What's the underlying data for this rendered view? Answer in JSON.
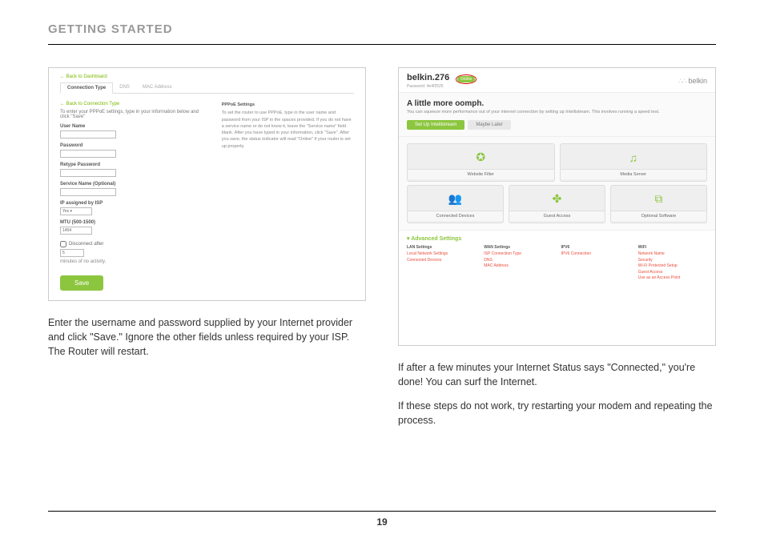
{
  "section_title": "GETTING STARTED",
  "page_number": "19",
  "left": {
    "shot": {
      "back_dashboard": "← Back to Dashboard",
      "tabs": [
        "Connection Type",
        "DNS",
        "MAC Address"
      ],
      "back_ct": "← Back to Connection Type",
      "intro": "To enter your PPPoE settings, type in your information below and click \"Save\"",
      "labels": {
        "user": "User Name",
        "pass": "Password",
        "repass": "Retype Password",
        "service": "Service Name (Optional)",
        "ipisp": "IP assigned by ISP",
        "ipisp_val": "Yes ▾",
        "mtu": "MTU (500-1500)",
        "mtu_val": "1454",
        "disc": "Disconnect after",
        "disc_val": "5",
        "activity": "minutes of no activity."
      },
      "save": "Save",
      "help_title": "PPPoE Settings",
      "help_body": "To set the router to use PPPoE, type in the user name and password from your ISP in the spaces provided. If you do not have a service name or do not know it, leave the \"Service name\" field blank. After you have typed in your information, click \"Save\". After you save, the status indicator will read \"Online\" if your router is set up properly."
    },
    "caption": "Enter the username and password supplied by your Internet provider and click \"Save.\" Ignore the other fields unless required by your ISP. The Router will restart."
  },
  "right": {
    "shot": {
      "name": "belkin.276",
      "password_label": "Password: 4e4f2525",
      "status": "Online",
      "logo": "belkin",
      "oomph_h": "A little more oomph.",
      "oomph_p": "You can squeeze more performance out of your internet connection by setting up Intellistream. This involves running a speed test.",
      "btn_setup": "Set Up Intellistream",
      "btn_later": "Maybe Later",
      "tiles_top": [
        "Website Filter",
        "Media Server"
      ],
      "tiles_bottom": [
        "Connected Devices",
        "Guest Access",
        "Optional Software"
      ],
      "adv_title": "▾ Advanced Settings",
      "adv": {
        "lan": {
          "h": "LAN Settings",
          "links": [
            "Local Network Settings",
            "Connected Devices"
          ]
        },
        "wan": {
          "h": "WAN Settings",
          "links": [
            "ISP Connection Type",
            "DNS",
            "MAC Address"
          ]
        },
        "ipv6": {
          "h": "IPV6",
          "links": [
            "IPV6 Connection"
          ]
        },
        "wifi": {
          "h": "WiFi",
          "links": [
            "Network Name",
            "Security",
            "Wi-Fi Protected Setup",
            "Guest Access",
            "Use as an Access Point"
          ]
        }
      }
    },
    "caption1": "If after a few minutes your Internet Status says \"Connected,\" you're done! You can surf the Internet.",
    "caption2": "If these steps do not work, try restarting your modem and repeating the process."
  }
}
